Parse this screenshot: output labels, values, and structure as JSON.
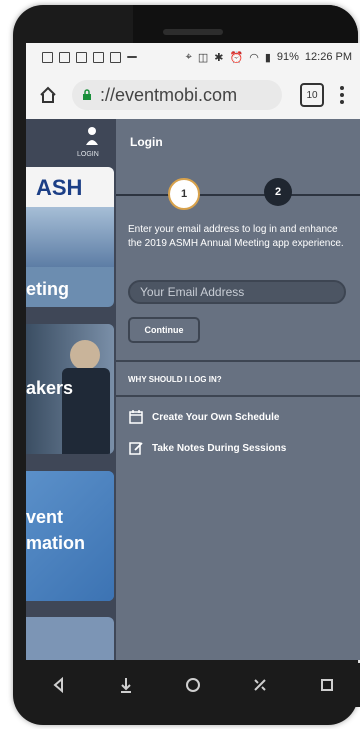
{
  "statusbar": {
    "battery": "91%",
    "time": "12:26 PM",
    "icons": [
      "facebook-icon",
      "image-icon",
      "messenger-icon",
      "messenger-icon",
      "calendar-icon",
      "dash-icon",
      "location-icon",
      "nfc-icon",
      "bluetooth-icon",
      "alarm-icon",
      "wifi-icon",
      "signal-icon"
    ]
  },
  "browser": {
    "url": "://eventmobi.com",
    "tab_count": "10",
    "icons": [
      "home-icon",
      "lock-icon",
      "tabs-icon",
      "menu-icon"
    ]
  },
  "left_panel": {
    "login_label": "LOGIN",
    "logo_text": "ASH",
    "cards": [
      {
        "label": "eting"
      },
      {
        "label": "akers"
      },
      {
        "label_line1": "vent",
        "label_line2": "mation"
      }
    ]
  },
  "login_panel": {
    "title": "Login",
    "steps": [
      "1",
      "2"
    ],
    "instruction": "Enter your email address to log in and enhance the 2019 ASMH Annual Meeting app experience.",
    "email_placeholder": "Your Email Address",
    "continue_label": "Continue",
    "why_title": "WHY SHOULD I LOG IN?",
    "benefits": [
      {
        "icon": "calendar-icon",
        "text": "Create Your Own Schedule"
      },
      {
        "icon": "edit-icon",
        "text": "Take Notes During Sessions"
      }
    ]
  },
  "navbar": {
    "icons": [
      "back-icon",
      "download-icon",
      "home-icon",
      "tools-icon",
      "square-icon"
    ]
  },
  "colors": {
    "panel_bg": "#677181",
    "left_bg": "#3f4757",
    "card_blue": "#5a7ea4",
    "divider": "#3d4552"
  }
}
